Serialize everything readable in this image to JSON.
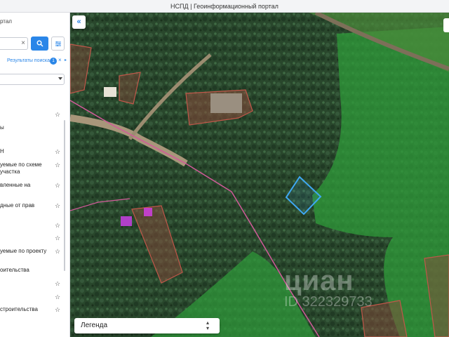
{
  "window": {
    "title": "НСПД | Геоинформационный портал"
  },
  "sidebar": {
    "header_fragment": "ртал",
    "search": {
      "value": "",
      "placeholder": ""
    },
    "results": {
      "label": "Результаты поиска",
      "count": "1"
    },
    "select_value": "",
    "layers": [
      {
        "label": "",
        "starred": true
      },
      {
        "label": "ы",
        "starred": false
      },
      {
        "label": "Н",
        "starred": true
      },
      {
        "label": "уемые по схеме",
        "starred": true
      },
      {
        "label": "участка",
        "starred": false
      },
      {
        "label": "вленные на",
        "starred": true
      },
      {
        "label": "дные от прав",
        "starred": true
      },
      {
        "label": "",
        "starred": true
      },
      {
        "label": "",
        "starred": true
      },
      {
        "label": "уемые по проекту",
        "starred": true
      },
      {
        "label": "оительства",
        "starred": false
      },
      {
        "label": "",
        "starred": true
      },
      {
        "label": "",
        "starred": true
      },
      {
        "label": "строительства",
        "starred": true
      }
    ]
  },
  "map": {
    "legend_label": "Легенда",
    "watermark": {
      "brand": "циан",
      "id": "ID 322329733"
    },
    "colors": {
      "forest_zone": "#2f9b3a",
      "parcel_fill": "#8a4b3c",
      "parcel_stroke": "#c0574a",
      "selected_parcel": "#3fa8f2",
      "boundary_line": "#d25a9a"
    }
  },
  "icons": [
    "search-icon",
    "clear-icon",
    "filter-icon",
    "star-icon",
    "chevron-double-left-icon",
    "sort-caret-icon"
  ]
}
